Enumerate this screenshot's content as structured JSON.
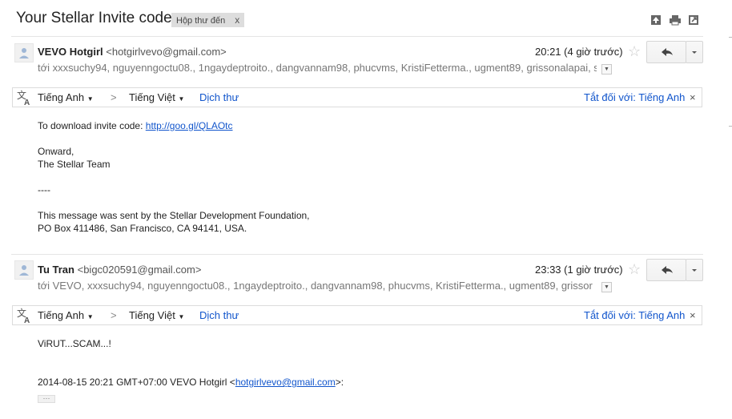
{
  "subject": "Your Stellar Invite code",
  "label": {
    "text": "Hộp thư đến",
    "remove": "x"
  },
  "messages": [
    {
      "sender_name": "VEVO Hotgirl",
      "sender_email": "<hotgirlvevo@gmail.com>",
      "time": "20:21 (4 giờ trước)",
      "recipients": "tới xxxsuchy94, nguyenngoctu08., 1ngaydeptroito., dangvannam98, phucvms, KristiFetterma., ugment89, grissonalapai, s",
      "translate": {
        "from": "Tiếng Anh",
        "arrow": ">",
        "to": "Tiếng Việt",
        "action": "Dịch thư",
        "off": "Tắt đối với: Tiếng Anh",
        "close": "×"
      },
      "body": {
        "line1_prefix": "To download invite code: ",
        "link": "http://goo.gl/QLAOtc",
        "line2": "Onward,",
        "line3": "The Stellar Team",
        "line4": "----",
        "line5": "This message was sent by the Stellar Development Foundation,",
        "line6": "PO Box 411486, San Francisco, CA 94141, USA."
      }
    },
    {
      "sender_name": "Tu Tran",
      "sender_email": "<bigc020591@gmail.com>",
      "time": "23:33 (1 giờ trước)",
      "recipients": "tới VEVO, xxxsuchy94, nguyenngoctu08., 1ngaydeptroito., dangvannam98, phucvms, KristiFetterma., ugment89, grissor",
      "translate": {
        "from": "Tiếng Anh",
        "arrow": ">",
        "to": "Tiếng Việt",
        "action": "Dịch thư",
        "off": "Tắt đối với: Tiếng Anh",
        "close": "×"
      },
      "body": {
        "line1": "ViRUT...SCAM...!",
        "quote_prefix": "2014-08-15 20:21 GMT+07:00 VEVO Hotgirl <",
        "quote_link": "hotgirlvevo@gmail.com",
        "quote_suffix": ">:",
        "expand": "···"
      }
    }
  ]
}
